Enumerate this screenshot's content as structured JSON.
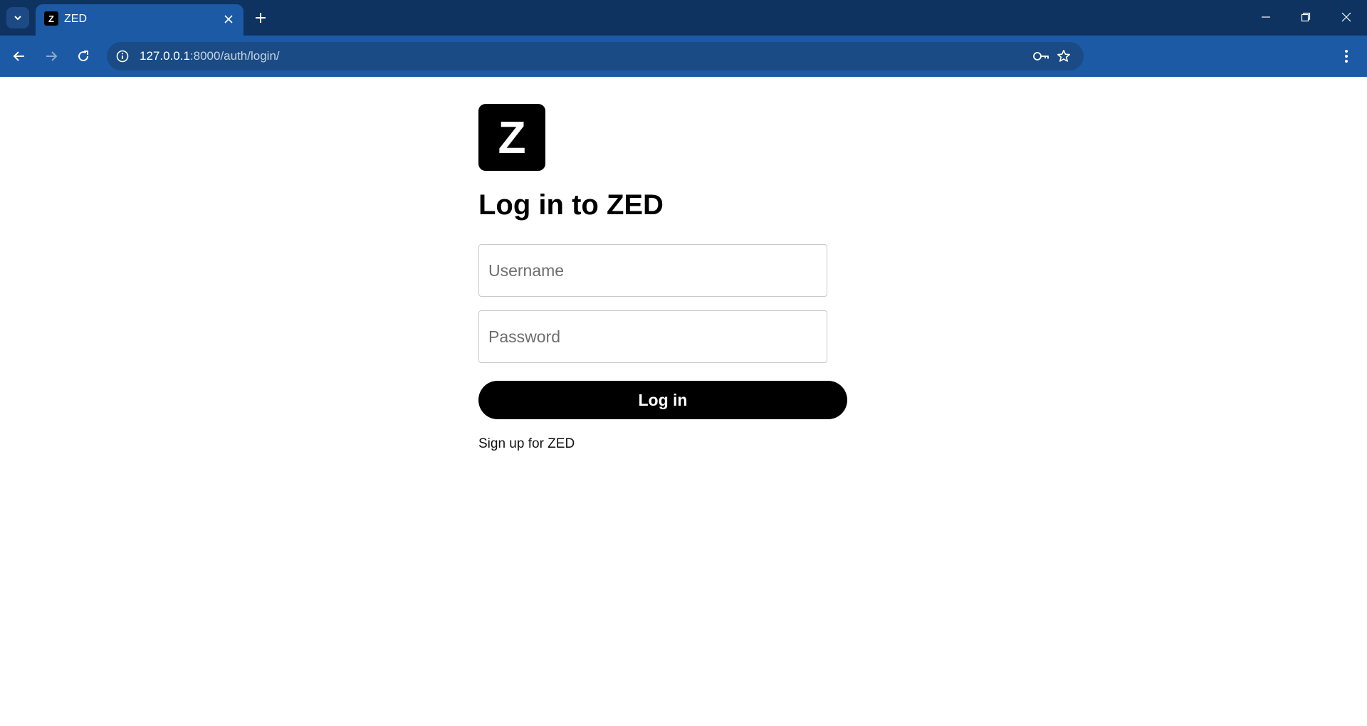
{
  "browser": {
    "tab": {
      "favicon": "Z",
      "title": "ZED"
    },
    "address": {
      "host": "127.0.0.1",
      "rest": ":8000/auth/login/"
    }
  },
  "icons": {
    "tab_search": "chevron-down-icon",
    "tab_close": "close-icon",
    "new_tab": "plus-icon",
    "back": "arrow-left-icon",
    "forward": "arrow-right-icon",
    "reload": "reload-icon",
    "site_info": "info-icon",
    "password_manager": "key-icon",
    "bookmark": "star-icon",
    "menu": "kebab-menu-icon"
  },
  "login": {
    "logo_letter": "Z",
    "title": "Log in to ZED",
    "username_placeholder": "Username",
    "password_placeholder": "Password",
    "submit_label": "Log in",
    "signup_link": "Sign up for ZED"
  },
  "colors": {
    "tabbar": "#0f3360",
    "toolbar": "#1c5aa6",
    "accent": "#000000"
  }
}
